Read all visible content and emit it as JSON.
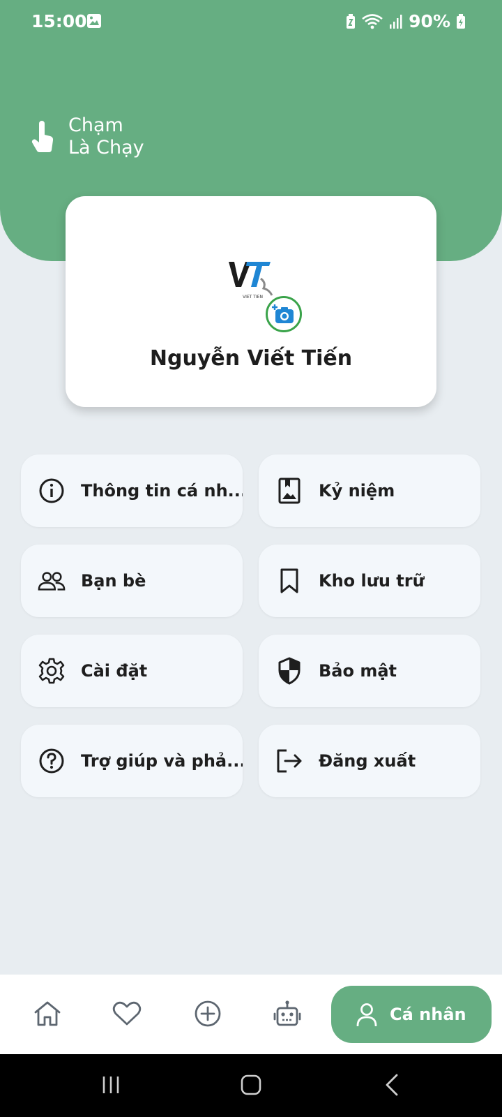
{
  "status_bar": {
    "time": "15:00",
    "battery": "90%"
  },
  "header": {
    "brand_line1": "Chạm",
    "brand_line2": "Là Chạy"
  },
  "profile": {
    "name": "Nguyễn Viết Tiến",
    "avatar_text": "VIET TIEN"
  },
  "menu": {
    "personal_info": "Thông tin cá nh...",
    "memories": "Kỷ niệm",
    "friends": "Bạn bè",
    "storage": "Kho lưu trữ",
    "settings": "Cài đặt",
    "security": "Bảo mật",
    "help": "Trợ giúp và phả...",
    "logout": "Đăng xuất"
  },
  "bottom_nav": {
    "active_label": "Cá nhân"
  },
  "colors": {
    "accent": "#66ae82",
    "background": "#e8edf1",
    "card": "#f3f7fb"
  }
}
